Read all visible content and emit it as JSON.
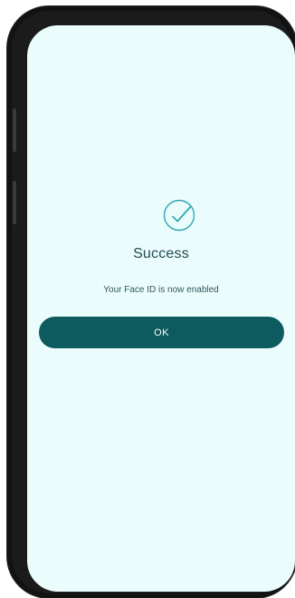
{
  "dialog": {
    "icon": "check-circle-icon",
    "title": "Success",
    "message": "Your Face ID is now enabled",
    "ok_label": "OK"
  },
  "colors": {
    "background": "#ebfcfc",
    "accent": "#0d5a5f",
    "icon": "#2aa6b0",
    "text": "#1f4a50"
  }
}
